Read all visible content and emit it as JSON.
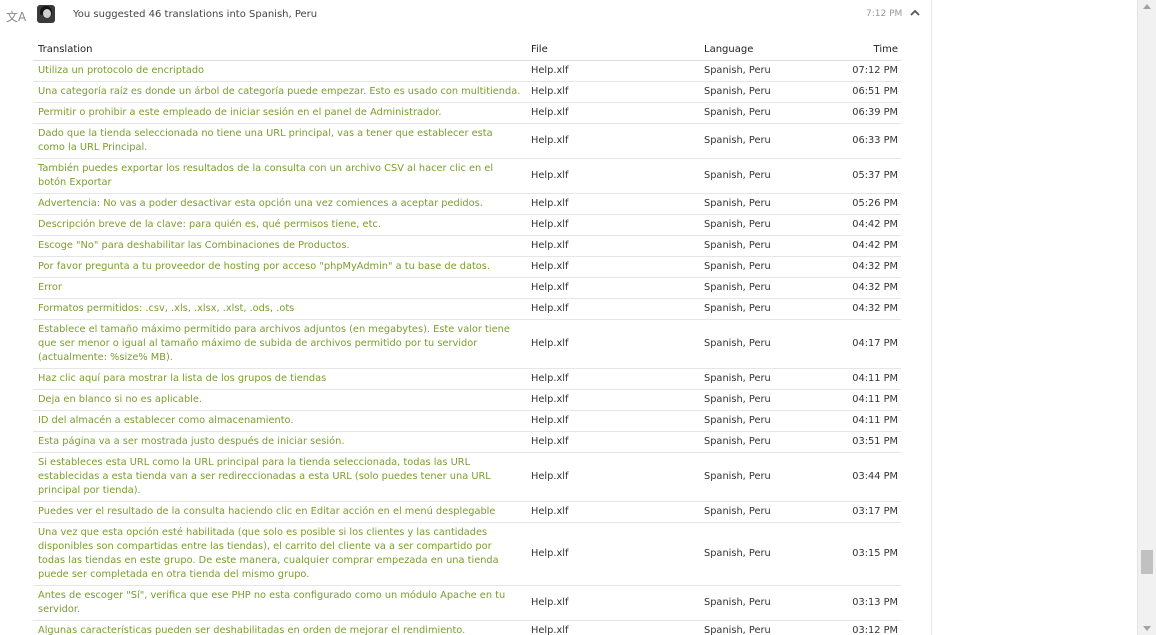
{
  "header": {
    "lang_icon": "文A",
    "icon_name": "translate-icon",
    "summary": "You suggested 46 translations into Spanish, Peru",
    "time": "7:12 PM",
    "accent": "#7a9e2c"
  },
  "table": {
    "columns": [
      "Translation",
      "File",
      "Language",
      "Time"
    ],
    "rows": [
      {
        "t": "Utiliza un protocolo de encriptado",
        "f": "Help.xlf",
        "l": "Spanish, Peru",
        "time": "07:12 PM"
      },
      {
        "t": "Una categoría raíz es donde un árbol de categoría puede empezar. Esto es usado con multitienda.",
        "f": "Help.xlf",
        "l": "Spanish, Peru",
        "time": "06:51 PM"
      },
      {
        "t": "Permitir o prohibir a este empleado de iniciar sesión en el panel de Administrador.",
        "f": "Help.xlf",
        "l": "Spanish, Peru",
        "time": "06:39 PM"
      },
      {
        "t": "Dado que la tienda seleccionada no tiene una URL principal, vas a tener que establecer esta como la URL Principal.",
        "f": "Help.xlf",
        "l": "Spanish, Peru",
        "time": "06:33 PM"
      },
      {
        "t": "También puedes exportar los resultados de la consulta con un archivo CSV al hacer clic en el botón Exportar",
        "f": "Help.xlf",
        "l": "Spanish, Peru",
        "time": "05:37 PM"
      },
      {
        "t": "Advertencia: No vas a poder desactivar esta opción una vez comiences a aceptar pedidos.",
        "f": "Help.xlf",
        "l": "Spanish, Peru",
        "time": "05:26 PM"
      },
      {
        "t": "Descripción breve de la clave: para quién es, qué permisos tiene, etc.",
        "f": "Help.xlf",
        "l": "Spanish, Peru",
        "time": "04:42 PM"
      },
      {
        "t": "Escoge \"No\" para deshabilitar las Combinaciones de Productos.",
        "f": "Help.xlf",
        "l": "Spanish, Peru",
        "time": "04:42 PM"
      },
      {
        "t": "Por favor pregunta a tu proveedor de hosting por acceso \"phpMyAdmin\" a tu base de datos.",
        "f": "Help.xlf",
        "l": "Spanish, Peru",
        "time": "04:32 PM"
      },
      {
        "t": "Error",
        "f": "Help.xlf",
        "l": "Spanish, Peru",
        "time": "04:32 PM"
      },
      {
        "t": "Formatos permitidos: .csv, .xls, .xlsx, .xlst, .ods, .ots",
        "f": "Help.xlf",
        "l": "Spanish, Peru",
        "time": "04:32 PM"
      },
      {
        "t": "Establece el tamaño máximo permitido para archivos adjuntos (en megabytes). Este valor tiene que ser menor o igual al tamaño máximo de subida de archivos permitido por tu servidor (actualmente: %size% MB).",
        "f": "Help.xlf",
        "l": "Spanish, Peru",
        "time": "04:17 PM"
      },
      {
        "t": "Haz clic aquí para mostrar la lista de los grupos de tiendas",
        "f": "Help.xlf",
        "l": "Spanish, Peru",
        "time": "04:11 PM"
      },
      {
        "t": "Deja en blanco si no es aplicable.",
        "f": "Help.xlf",
        "l": "Spanish, Peru",
        "time": "04:11 PM"
      },
      {
        "t": "ID del almacén a establecer como almacenamiento.",
        "f": "Help.xlf",
        "l": "Spanish, Peru",
        "time": "04:11 PM"
      },
      {
        "t": "Esta página va a ser mostrada justo después de iniciar sesión.",
        "f": "Help.xlf",
        "l": "Spanish, Peru",
        "time": "03:51 PM"
      },
      {
        "t": "Si estableces esta URL como la URL principal para la tienda seleccionada, todas las URL establecidas a esta tienda van a ser redireccionadas a esta URL (solo puedes tener una URL principal por tienda).",
        "f": "Help.xlf",
        "l": "Spanish, Peru",
        "time": "03:44 PM"
      },
      {
        "t": "Puedes ver el resultado de la consulta haciendo clic en Editar acción en el menú desplegable",
        "f": "Help.xlf",
        "l": "Spanish, Peru",
        "time": "03:17 PM"
      },
      {
        "t": "Una vez que esta opción esté habilitada (que solo es posible si los clientes y las cantidades disponibles son compartidas entre las tiendas), el carrito del cliente va a ser compartido por todas las tiendas en este grupo. De este manera, cualquier comprar empezada en una tienda puede ser completada en otra tienda del mismo grupo.",
        "f": "Help.xlf",
        "l": "Spanish, Peru",
        "time": "03:15 PM"
      },
      {
        "t": "Antes de escoger \"Sí\", verifica que ese PHP no esta configurado como un módulo Apache en tu servidor.",
        "f": "Help.xlf",
        "l": "Spanish, Peru",
        "time": "03:13 PM"
      },
      {
        "t": "Algunas características pueden ser deshabilitadas en orden de mejorar el rendimiento.",
        "f": "Help.xlf",
        "l": "Spanish, Peru",
        "time": "03:12 PM"
      }
    ]
  }
}
